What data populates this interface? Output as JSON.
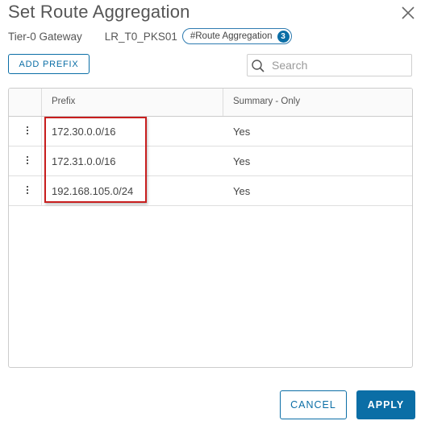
{
  "dialog": {
    "title": "Set Route Aggregation",
    "close_icon": "close-icon"
  },
  "meta": {
    "gateway_label": "Tier-0 Gateway",
    "gateway_name": "LR_T0_PKS01",
    "tag_label": "#Route Aggregation",
    "tag_count": "3"
  },
  "toolbar": {
    "add_prefix_label": "ADD PREFIX",
    "search_placeholder": "Search",
    "search_value": ""
  },
  "table": {
    "columns": [
      "Prefix",
      "Summary - Only"
    ],
    "rows": [
      {
        "prefix": "172.30.0.0/16",
        "summary_only": "Yes"
      },
      {
        "prefix": "172.31.0.0/16",
        "summary_only": "Yes"
      },
      {
        "prefix": "192.168.105.0/24",
        "summary_only": "Yes"
      }
    ],
    "row_menu_icon": "vertical-ellipsis-icon"
  },
  "footer": {
    "cancel_label": "CANCEL",
    "apply_label": "APPLY"
  },
  "colors": {
    "accent": "#0b6ea6",
    "highlight_border": "#c81e1e"
  }
}
